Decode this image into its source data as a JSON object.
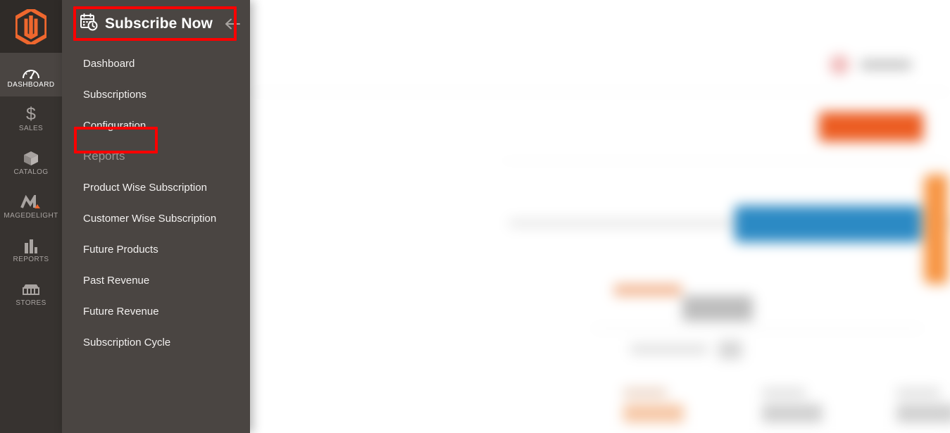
{
  "app": {
    "logo_icon": "magento-logo-icon",
    "brand_color": "#ee672e"
  },
  "rail": {
    "items": [
      {
        "label": "DASHBOARD",
        "icon": "dashboard-gauge-icon",
        "active": true
      },
      {
        "label": "SALES",
        "icon": "dollar-sign-icon",
        "active": false
      },
      {
        "label": "CATALOG",
        "icon": "catalog-box-icon",
        "active": false
      },
      {
        "label": "MAGEDELIGHT",
        "icon": "magedelight-icon",
        "active": false
      },
      {
        "label": "REPORTS",
        "icon": "bar-chart-icon",
        "active": false
      },
      {
        "label": "STORES",
        "icon": "storefront-icon",
        "active": false
      }
    ]
  },
  "flyout": {
    "title": "Subscribe Now",
    "title_icon": "calendar-clock-icon",
    "back_icon": "arrow-left-icon",
    "items": [
      {
        "label": "Dashboard",
        "type": "item",
        "highlighted": false
      },
      {
        "label": "Subscriptions",
        "type": "item",
        "highlighted": false
      },
      {
        "label": "Configuration",
        "type": "item",
        "highlighted": true
      },
      {
        "label": "Reports",
        "type": "section",
        "highlighted": false
      },
      {
        "label": "Product Wise Subscription",
        "type": "item",
        "highlighted": false
      },
      {
        "label": "Customer Wise Subscription",
        "type": "item",
        "highlighted": false
      },
      {
        "label": "Future Products",
        "type": "item",
        "highlighted": false
      },
      {
        "label": "Past Revenue",
        "type": "item",
        "highlighted": false
      },
      {
        "label": "Future Revenue",
        "type": "item",
        "highlighted": false
      },
      {
        "label": "Subscription Cycle",
        "type": "item",
        "highlighted": false
      }
    ]
  },
  "annotations": {
    "color": "#fb0000",
    "boxes": [
      {
        "target": "flyout-title",
        "name": "subscribe-now-title-highlight"
      },
      {
        "target": "Configuration",
        "name": "configuration-menu-highlight"
      }
    ]
  },
  "backdrop": {
    "state": "blurred-admin-page",
    "colors": {
      "primary_button": "#ec5d22",
      "secondary_button": "#2c8ac4",
      "side_tab": "#f79543",
      "badge": "#f0b7b7"
    }
  }
}
